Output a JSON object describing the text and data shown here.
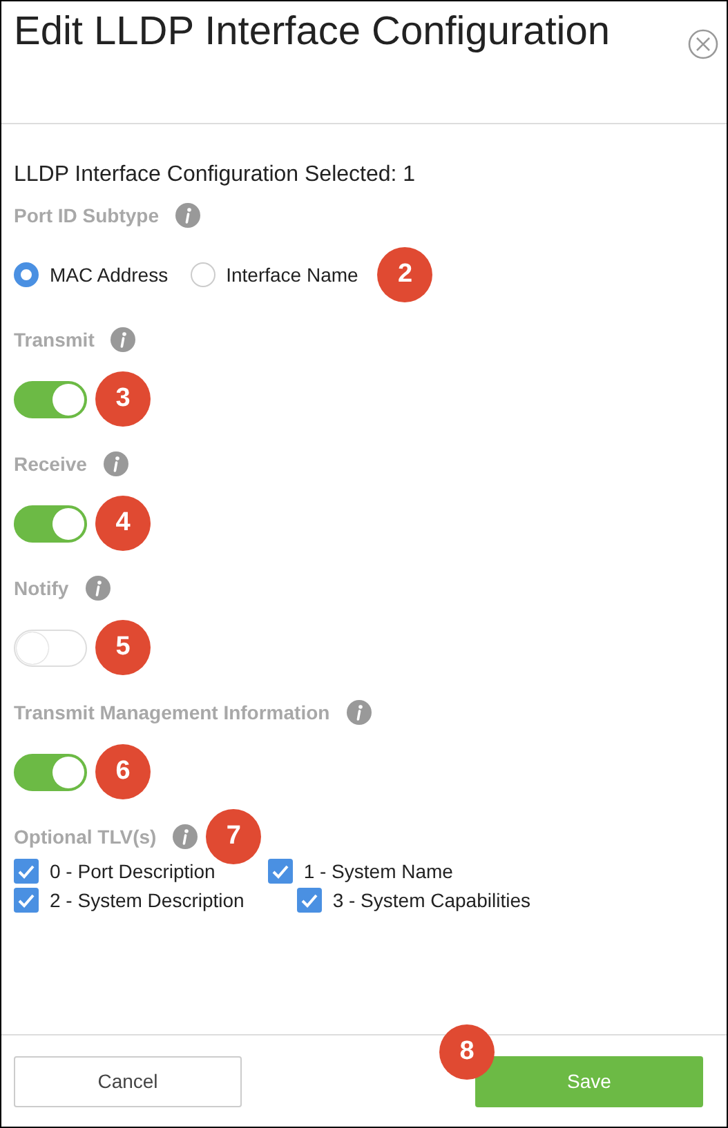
{
  "dialog": {
    "title": "Edit LLDP Interface Configuration"
  },
  "selected_count": "LLDP Interface Configuration Selected: 1",
  "sections": [
    {
      "kind": "radio",
      "label": "Port ID Subtype",
      "callout": "2",
      "options": [
        {
          "label": "MAC Address",
          "selected": true
        },
        {
          "label": "Interface Name",
          "selected": false
        }
      ]
    },
    {
      "kind": "toggle",
      "label": "Transmit",
      "callout": "3",
      "on": true
    },
    {
      "kind": "toggle",
      "label": "Receive",
      "callout": "4",
      "on": true
    },
    {
      "kind": "toggle",
      "label": "Notify",
      "callout": "5",
      "on": false
    },
    {
      "kind": "toggle",
      "label": "Transmit Management Information",
      "callout": "6",
      "on": true
    },
    {
      "kind": "checkboxes",
      "label": "Optional TLV(s)",
      "callout": "7",
      "options": [
        {
          "label": "0 - Port Description",
          "checked": true
        },
        {
          "label": "1 - System Name",
          "checked": true
        },
        {
          "label": "2 - System Description",
          "checked": true
        },
        {
          "label": "3 - System Capabilities",
          "checked": true
        }
      ]
    }
  ],
  "buttons": [
    {
      "kind": "secondary",
      "label": "Cancel"
    },
    {
      "kind": "primary",
      "label": "Save",
      "callout": "8"
    }
  ]
}
